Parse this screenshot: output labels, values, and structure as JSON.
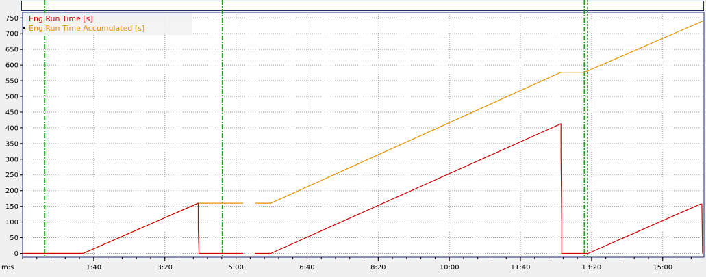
{
  "chart_data": {
    "type": "line",
    "x_unit_label": "m:s",
    "x_tick_labels": [
      "1:40",
      "3:20",
      "5:00",
      "6:40",
      "8:20",
      "10:00",
      "11:40",
      "13:20",
      "15:00"
    ],
    "x_tick_seconds": [
      100,
      200,
      300,
      400,
      500,
      600,
      700,
      800,
      900
    ],
    "y_ticks": [
      0,
      50,
      100,
      150,
      200,
      250,
      300,
      350,
      400,
      450,
      500,
      550,
      600,
      650,
      700,
      750
    ],
    "xlim": [
      0,
      958
    ],
    "ylim": [
      -12,
      768
    ],
    "grid": true,
    "legend_position": "top-left",
    "markers_seconds": [
      {
        "t": 31,
        "style": "dashdot",
        "color": "#1a9e1a"
      },
      {
        "t": 37,
        "style": "dash",
        "color": "#1a9e1a"
      },
      {
        "t": 281,
        "style": "dashdot",
        "color": "#1a9e1a"
      },
      {
        "t": 790,
        "style": "dashdot",
        "color": "#1a9e1a"
      },
      {
        "t": 794,
        "style": "dash",
        "color": "#1a9e1a"
      }
    ],
    "series": [
      {
        "name": "Eng Run Time [s]",
        "color": "#cc0000",
        "segments": [
          [
            [
              0,
              0
            ],
            [
              85,
              0
            ],
            [
              247,
              160
            ],
            [
              247,
              80
            ],
            [
              248,
              0
            ],
            [
              310,
              0
            ]
          ],
          [
            [
              327,
              0
            ],
            [
              349,
              0
            ],
            [
              757,
              413
            ],
            [
              757,
              310
            ],
            [
              758,
              100
            ],
            [
              758,
              0
            ],
            [
              788,
              0
            ],
            [
              795,
              0
            ],
            [
              953,
              157
            ],
            [
              955,
              157
            ],
            [
              956,
              0
            ]
          ]
        ]
      },
      {
        "name": "Eng Run Time Accumulated [s]",
        "color": "#e69100",
        "segments": [
          [
            [
              0,
              0
            ],
            [
              85,
              0
            ],
            [
              247,
              160
            ],
            [
              310,
              160
            ]
          ],
          [
            [
              327,
              160
            ],
            [
              349,
              160
            ],
            [
              757,
              577
            ],
            [
              790,
              577
            ],
            [
              956,
              740
            ]
          ]
        ]
      }
    ]
  }
}
